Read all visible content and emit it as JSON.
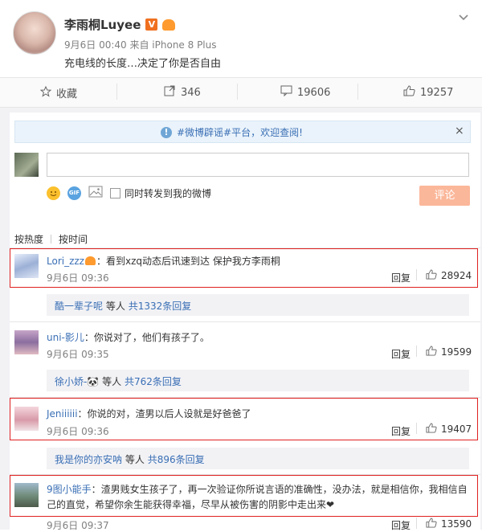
{
  "post": {
    "author": "李雨桐Luyee",
    "verified_badge": "V",
    "meta": "9月6日 00:40 来自 iPhone 8 Plus",
    "text": "充电线的长度…决定了你是否自由"
  },
  "actions": {
    "favorite": "收藏",
    "repost_count": "346",
    "comment_count": "19606",
    "like_count": "19257"
  },
  "notice": {
    "text": "#微博辟谣#平台，欢迎查阅!",
    "close": "×"
  },
  "composer": {
    "input_value": "",
    "sync_label": "同时转发到我的微博",
    "submit": "评论"
  },
  "sort": {
    "hot": "按热度",
    "time": "按时间"
  },
  "comments": [
    {
      "user": "Lori_zzz",
      "text": "：看到xzq动态后讯速到达 保护我方李雨桐",
      "time": "9月6日 09:36",
      "reply": "回复",
      "likes": "28924"
    },
    {
      "user": "uni-影儿",
      "text": "：你说对了，他们有孩子了。",
      "time": "9月6日 09:35",
      "reply": "回复",
      "likes": "19599"
    },
    {
      "user": "Jeniiiiii",
      "text": "：你说的对，渣男以后人设就是好爸爸了",
      "time": "9月6日 09:36",
      "reply": "回复",
      "likes": "19407"
    },
    {
      "user": "9图小能手",
      "text": "：渣男贱女生孩子了，再一次验证你所说言语的准确性，没办法，就是相信你，我相信自己的直觉，希望你余生能获得幸福，尽早从被伤害的阴影中走出来❤",
      "time": "9月6日 09:37",
      "reply": "回复",
      "likes": "13590"
    }
  ],
  "reply_summaries": [
    {
      "user": "酷一辈子呢",
      "etc": "等人",
      "count": "共1332条回复"
    },
    {
      "user": "徐小娇-🐼",
      "etc": "等人",
      "count": "共762条回复"
    },
    {
      "user": "我是你的亦安呐",
      "etc": "等人",
      "count": "共896条回复"
    }
  ]
}
